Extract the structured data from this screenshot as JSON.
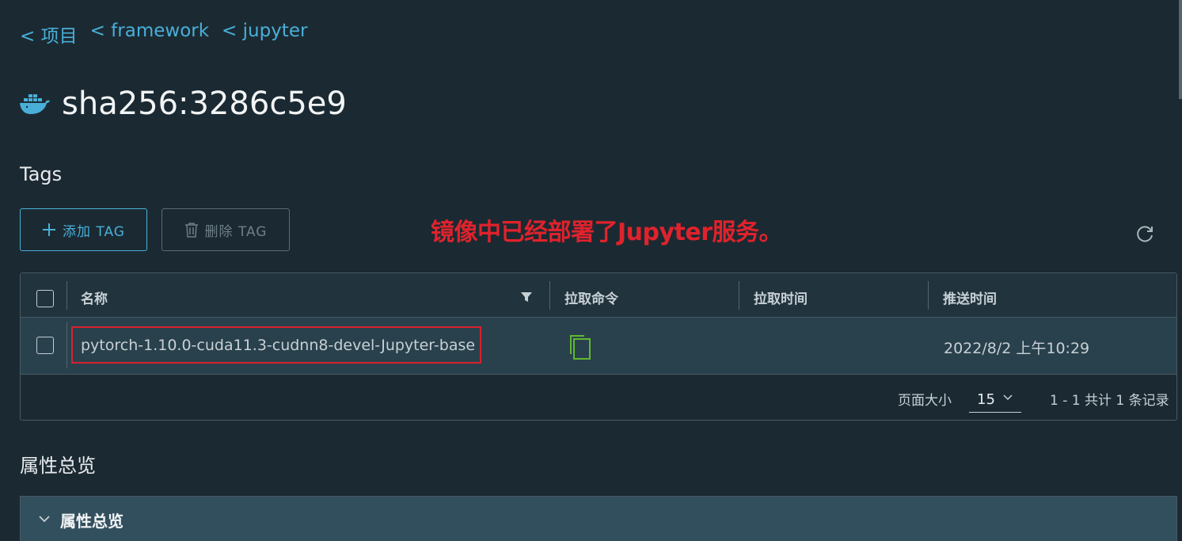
{
  "breadcrumb": [
    {
      "label": "< 项目"
    },
    {
      "label": "< framework"
    },
    {
      "label": "< jupyter"
    }
  ],
  "page_title": "sha256:3286c5e9",
  "tags_section": {
    "title": "Tags",
    "add_button": "添加 TAG",
    "delete_button": "删除 TAG"
  },
  "annotation_text": "镜像中已经部署了Jupyter服务。",
  "table": {
    "columns": [
      "名称",
      "拉取命令",
      "拉取时间",
      "推送时间"
    ],
    "rows": [
      {
        "name": "pytorch-1.10.0-cuda11.3-cudnn8-devel-Jupyter-base",
        "pull_time": "",
        "push_time": "2022/8/2 上午10:29"
      }
    ],
    "footer": {
      "page_size_label": "页面大小",
      "page_size_value": "15",
      "pagination_info": "1 - 1 共计 1 条记录"
    }
  },
  "properties_section": {
    "title": "属性总览",
    "accordion_label": "属性总览"
  },
  "colors": {
    "background": "#1b2a32",
    "link": "#49afd9",
    "annotation": "#e0222c",
    "copy_icon": "#5fb830",
    "row_selected": "#29414d"
  },
  "icons": {
    "logo": "docker-whale-icon",
    "add": "plus-icon",
    "delete": "trash-icon",
    "refresh": "refresh-icon",
    "filter": "filter-icon",
    "copy": "copy-icon",
    "dropdown": "chevron-down-icon"
  }
}
